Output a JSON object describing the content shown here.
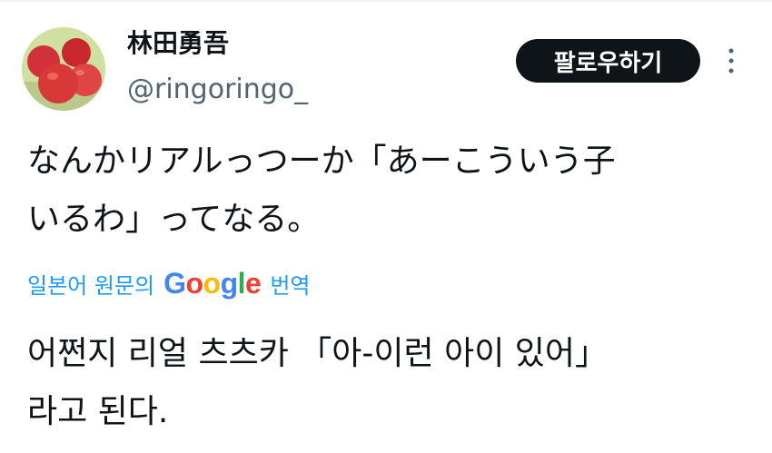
{
  "tweet": {
    "display_name": "林田勇吾",
    "handle": "@ringoringo_",
    "follow_label": "팔로우하기",
    "text_line1": "なんかリアルっつーか「あーこういう子",
    "text_line2": "いるわ」ってなる。",
    "translate": {
      "prefix": "일본어 원문의",
      "google_letters": [
        "G",
        "o",
        "o",
        "g",
        "l",
        "e"
      ],
      "suffix": "번역"
    },
    "translated_line1": "어쩐지 리얼 츠츠카 「아-이런 아이 있어」",
    "translated_line2": "라고 된다."
  },
  "icons": {
    "avatar": "apple-photo-avatar",
    "more": "more-vertical-icon"
  },
  "colors": {
    "accent": "#1d9bf0",
    "button_bg": "#0f1419",
    "secondary_text": "#536471"
  }
}
